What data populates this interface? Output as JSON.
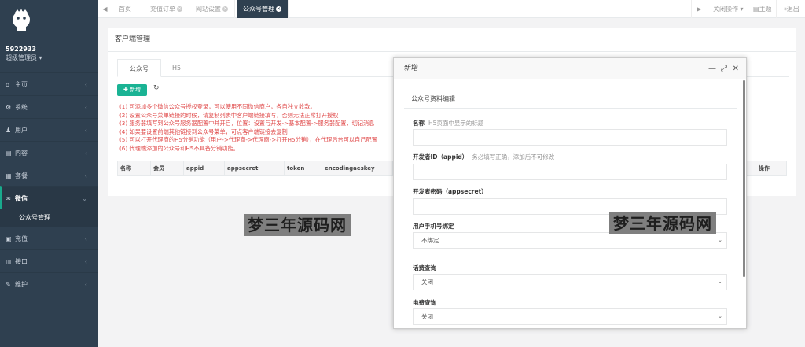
{
  "sidebar": {
    "user_id": "5922933",
    "role": "超级管理员",
    "items": [
      {
        "label": "主页",
        "icon": "home-icon",
        "glyph": "⌂"
      },
      {
        "label": "系统",
        "icon": "gear-icon",
        "glyph": "⚙"
      },
      {
        "label": "用户",
        "icon": "users-icon",
        "glyph": "♟"
      },
      {
        "label": "内容",
        "icon": "file-icon",
        "glyph": "▤"
      },
      {
        "label": "套餐",
        "icon": "package-icon",
        "glyph": "▦"
      },
      {
        "label": "微信",
        "icon": "wechat-icon",
        "glyph": "✉"
      },
      {
        "label": "充值",
        "icon": "recharge-icon",
        "glyph": "▣"
      },
      {
        "label": "接口",
        "icon": "api-icon",
        "glyph": "▥"
      },
      {
        "label": "维护",
        "icon": "wrench-icon",
        "glyph": "✎"
      }
    ],
    "active_sub": "公众号管理"
  },
  "topbar": {
    "tabs": [
      "首页",
      "充值订单",
      "网站设置",
      "公众号管理"
    ],
    "close_ops": "关闭操作",
    "theme": "主题",
    "logout": "退出"
  },
  "panel": {
    "title": "客户端管理",
    "subtabs": [
      "公众号",
      "H5"
    ],
    "add_label": "新增",
    "notes": [
      "(1) 可添加多个微信公众号授权登录，可以使用不同微信商户，各自独立收款。",
      "(2) 设置公众号菜单链接的时候，请复制列表中客户端链接填写，否则无法正常打开授权",
      "(3) 服务器填写到公众号服务器配置中并开启，位置：设置与开发->基本配置->服务器配置，切记消息",
      "(4) 如果要设置前端其他链接到公众号菜单，可点客户端链接去复制！",
      "(5) 可以打开代理商的H5分销功能（用户->代理商->代理商->打开H5分销），在代理后台可以自己配置",
      "(6) 代理端添加的公众号和H5不具备分销功能。"
    ],
    "columns": [
      "名称",
      "会员",
      "appid",
      "appsecret",
      "token",
      "encodingaeskey"
    ],
    "last_column": "操作"
  },
  "modal": {
    "title": "新增",
    "section_title": "公众号资料编辑",
    "fields": {
      "name_label": "名称",
      "name_hint": "H5页面中显示的标题",
      "appid_label": "开发者ID（appid）",
      "appid_hint": "务必填写正确，添加后不可修改",
      "secret_label": "开发者密码（appsecret）",
      "phone_label": "用户手机号绑定",
      "phone_value": "不绑定",
      "fee_label": "话费查询",
      "fee_value": "关闭",
      "elec_label": "电费查询",
      "elec_value": "关闭"
    }
  },
  "watermark": "梦三年源码网",
  "colors": {
    "sidebar_bg": "#2f4050",
    "accent": "#1ab394",
    "note_red": "#e04b4b"
  }
}
